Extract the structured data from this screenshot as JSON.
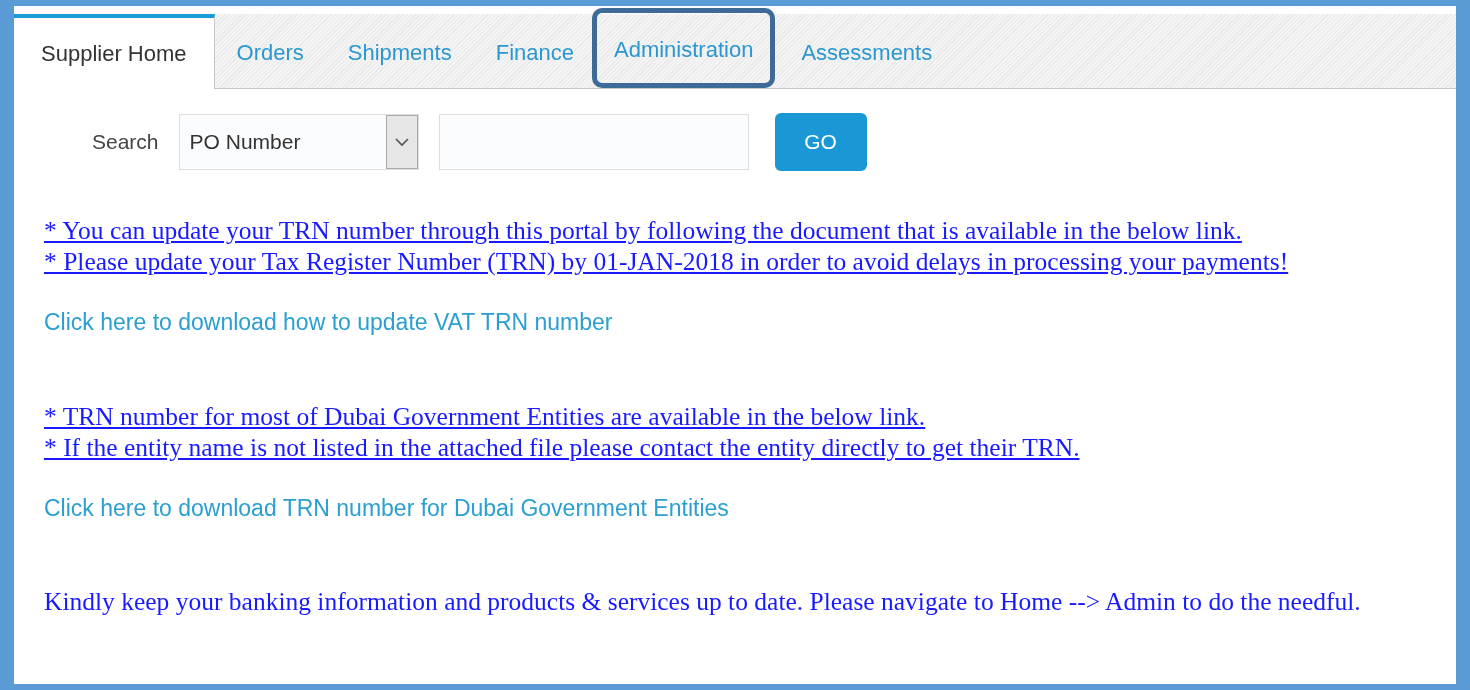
{
  "tabs": [
    {
      "label": "Supplier Home",
      "selected": true,
      "highlighted": false
    },
    {
      "label": "Orders",
      "selected": false,
      "highlighted": false
    },
    {
      "label": "Shipments",
      "selected": false,
      "highlighted": false
    },
    {
      "label": "Finance",
      "selected": false,
      "highlighted": false
    },
    {
      "label": "Administration",
      "selected": false,
      "highlighted": true
    },
    {
      "label": "Assessments",
      "selected": false,
      "highlighted": false
    }
  ],
  "search": {
    "label": "Search",
    "type_value": "PO Number",
    "button": "GO"
  },
  "blocks": [
    {
      "kind": "notice",
      "lines": [
        "* You can update your TRN number through this portal by following the document that is available in the below link.",
        "* Please update your Tax Register Number (TRN) by 01-JAN-2018 in order to avoid delays in processing your payments!"
      ]
    },
    {
      "kind": "link",
      "text": "Click here to download how to update VAT TRN number"
    },
    {
      "kind": "notice",
      "lines": [
        "* TRN number for most of Dubai Government Entities are available in the below link.",
        "* If the entity name is not listed in the attached file please contact the entity directly to get their TRN."
      ]
    },
    {
      "kind": "link",
      "text": "Click here to download TRN number for Dubai Government Entities"
    },
    {
      "kind": "message",
      "text": "Kindly keep your banking information and products & services up to date. Please navigate to Home --> Admin to do the needful."
    }
  ]
}
